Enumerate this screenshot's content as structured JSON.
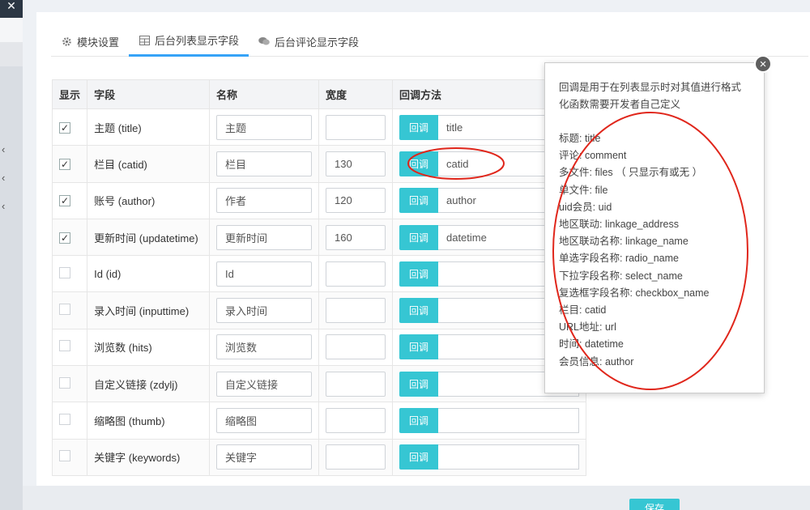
{
  "tabs": [
    {
      "label": "模块设置",
      "icon": "gear-icon"
    },
    {
      "label": "后台列表显示字段",
      "icon": "table-icon"
    },
    {
      "label": "后台评论显示字段",
      "icon": "comments-icon"
    }
  ],
  "table": {
    "headers": [
      "显示",
      "字段",
      "名称",
      "宽度",
      "回调方法"
    ],
    "callback_button_label": "回调",
    "rows": [
      {
        "checked": true,
        "field": "主题 (title)",
        "name": "主题",
        "width": "",
        "callback": "title"
      },
      {
        "checked": true,
        "field": "栏目 (catid)",
        "name": "栏目",
        "width": "130",
        "callback": "catid"
      },
      {
        "checked": true,
        "field": "账号 (author)",
        "name": "作者",
        "width": "120",
        "callback": "author"
      },
      {
        "checked": true,
        "field": "更新时间 (updatetime)",
        "name": "更新时间",
        "width": "160",
        "callback": "datetime"
      },
      {
        "checked": false,
        "field": "Id (id)",
        "name": "Id",
        "width": "",
        "callback": ""
      },
      {
        "checked": false,
        "field": "录入时间 (inputtime)",
        "name": "录入时间",
        "width": "",
        "callback": ""
      },
      {
        "checked": false,
        "field": "浏览数 (hits)",
        "name": "浏览数",
        "width": "",
        "callback": ""
      },
      {
        "checked": false,
        "field": "自定义链接 (zdylj)",
        "name": "自定义链接",
        "width": "",
        "callback": ""
      },
      {
        "checked": false,
        "field": "缩略图 (thumb)",
        "name": "缩略图",
        "width": "",
        "callback": ""
      },
      {
        "checked": false,
        "field": "关键字 (keywords)",
        "name": "关键字",
        "width": "",
        "callback": ""
      }
    ]
  },
  "popover": {
    "intro": "回调是用于在列表显示时对其值进行格式化函数需要开发者自己定义",
    "items": [
      "标题: title",
      "评论: comment",
      "多文件: files （ 只显示有或无 ）",
      "单文件: file",
      "uid会员: uid",
      "地区联动: linkage_address",
      "地区联动名称: linkage_name",
      "单选字段名称: radio_name",
      "下拉字段名称: select_name",
      "复选框字段名称: checkbox_name",
      "栏目: catid",
      "URL地址: url",
      "时间: datetime",
      "会员信息: author"
    ]
  },
  "save_label": "保存",
  "colors": {
    "accent": "#36c6d3",
    "tab_active": "#36a3f7",
    "annotation": "#e0261b"
  }
}
